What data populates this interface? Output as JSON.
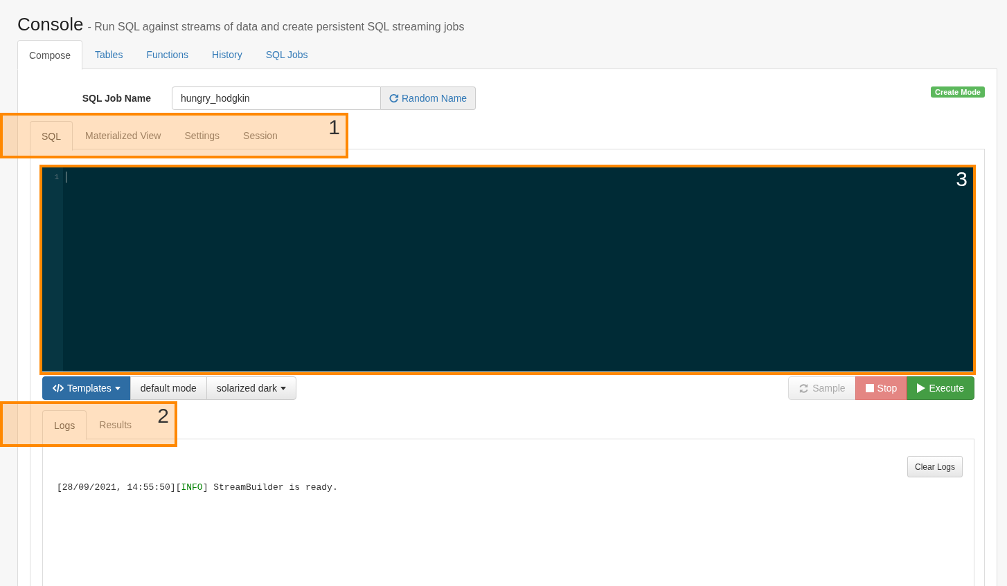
{
  "header": {
    "title": "Console",
    "subtitle": "- Run SQL against streams of data and create persistent SQL streaming jobs"
  },
  "tabs": [
    {
      "label": "Compose",
      "selected": true
    },
    {
      "label": "Tables",
      "selected": false
    },
    {
      "label": "Functions",
      "selected": false
    },
    {
      "label": "History",
      "selected": false
    },
    {
      "label": "SQL Jobs",
      "selected": false
    }
  ],
  "job_name": {
    "label": "SQL Job Name",
    "value": "hungry_hodgkin",
    "button": "Random Name"
  },
  "mode_badge": "Create Mode",
  "editor_tabs": [
    {
      "label": "SQL",
      "selected": true
    },
    {
      "label": "Materialized View",
      "selected": false
    },
    {
      "label": "Settings",
      "selected": false
    },
    {
      "label": "Session",
      "selected": false
    }
  ],
  "editor": {
    "line_numbers": [
      "1"
    ]
  },
  "toolbar": {
    "templates": "Templates",
    "keymap": "default mode",
    "theme": "solarized dark",
    "actions": [
      {
        "kind": "sample",
        "label": "Sample",
        "disabled": true
      },
      {
        "kind": "stop",
        "label": "Stop",
        "disabled": true
      },
      {
        "kind": "execute",
        "label": "Execute",
        "disabled": false
      }
    ]
  },
  "output_tabs": [
    {
      "label": "Logs",
      "selected": true
    },
    {
      "label": "Results",
      "selected": false
    }
  ],
  "logs": {
    "clear_button": "Clear Logs",
    "entries": [
      {
        "time": "[28/09/2021, 14:55:50][",
        "level": "INFO",
        "message": "] StreamBuilder is ready."
      }
    ]
  },
  "annotations": [
    {
      "label": "1"
    },
    {
      "label": "3"
    },
    {
      "label": "2"
    }
  ]
}
